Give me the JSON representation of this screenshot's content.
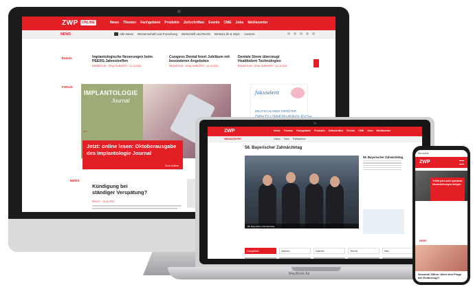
{
  "desktop": {
    "logo": "ZWP",
    "logo_badge": "ONLINE",
    "nav": [
      "News",
      "Themen",
      "Fachgebiete",
      "Produkte",
      "Zeitschriften",
      "Events",
      "CME",
      "Jobs",
      "Mediacenter"
    ],
    "subbar_label": "NEWS",
    "subnav": [
      "Alle News",
      "Wissenschaft und Forschung",
      "Wirtschaft und Recht",
      "Dental Life & Style",
      "Autoren"
    ],
    "section_events": "Events",
    "news": [
      {
        "title": "Implantologische Neuerungen beim PEERS-Jahrestreffen",
        "meta": "REDAKTION · ORAL SURGERY · 12.10.2021"
      },
      {
        "title": "Curaprox Dental feiert Jubiläum mit besonderen Angeboten",
        "meta": "REDAKTION · ORAL SURGERY · 12.10.2021"
      },
      {
        "title": "Dentale Sinne überzeugt Healthident Technologies",
        "meta": "REDAKTION · ORAL SURGERY · 12.10.2021"
      }
    ],
    "section_focus": "FOKUS",
    "hero_cover_title": "IMPLANTOLOGIE",
    "hero_cover_sub": "Journal",
    "hero_title": "Jetzt: online lesen: Oktoberausgabe des Implantologie Journal",
    "hero_more": "Zum Artikel",
    "ad_brand": "fokusdent",
    "ad_line1": "DEUTSCHLANDS GRÖßTER",
    "ad_line2": "DENTALPREISVERGLEICH",
    "section_news": "NEWS",
    "story_title": "Kündigung bei ständiger Verspätung?",
    "story_meta": "RECHT · 10.10.2021",
    "story_text": "Pünktlichkeit ist eine Zier, doch kommt man nicht weit ohne ihr."
  },
  "laptop": {
    "logo": "ZWP",
    "nav": [
      "News",
      "Themen",
      "Fachgebiete",
      "Produkte",
      "Zeitschriften",
      "Events",
      "CME",
      "Jobs",
      "Mediacenter"
    ],
    "subbar_label": "MEDIACENTER",
    "subnav": [
      "Videos",
      "Fotos",
      "Publikationen"
    ],
    "page_title": "58. Bayerischer Zahnärztetag",
    "photo_caption": "58. Bayerischer Zahnärztetag",
    "side_title": "58. Bayerischer Zahnärztetag",
    "tabs": [
      "Fachgebiete",
      "Aktionen",
      "Kalender",
      "Termine",
      "Mehr"
    ],
    "brand": "MacBook Air"
  },
  "phone": {
    "status": "Die.online",
    "logo": "ZWP",
    "hero_text": "Teilfrit jetzt auch sparsame Neueinführungen bringen",
    "section": "NEWS",
    "story_title": "Gesunde Zähne: Alles eine Frage der Ernährung?!"
  }
}
